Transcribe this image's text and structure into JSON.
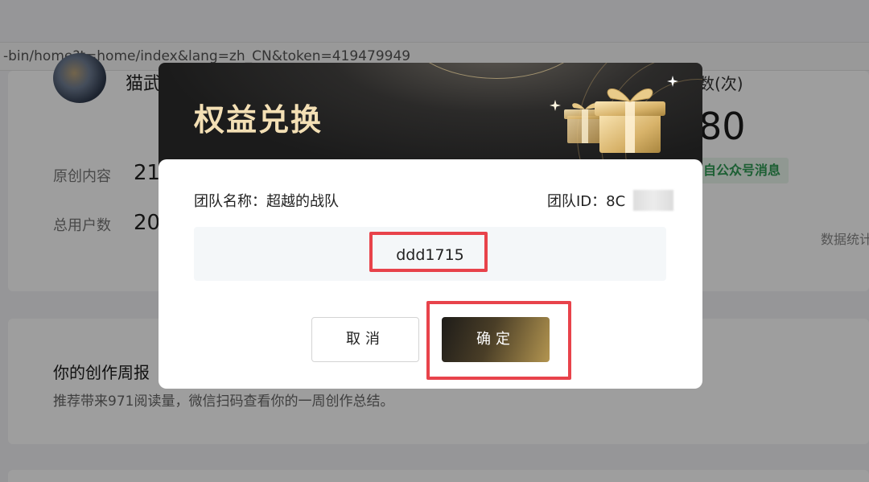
{
  "background": {
    "url_text": "-bin/home?t=home/index&lang=zh_CN&token=419479949",
    "account_name_partial": "猫武",
    "header_right_partial": "数(次)",
    "stats": [
      {
        "label": "原创内容",
        "value": "21"
      },
      {
        "label": "总用户数",
        "value": "20"
      }
    ],
    "big_number_partial": "80",
    "message_tag": "自公众号消息",
    "stats_link_partial": "数据统计",
    "weekly_report": {
      "title": "你的创作周报",
      "description": "推荐带来971阅读量，微信扫码查看你的一周创作总结。"
    }
  },
  "modal": {
    "title": "权益兑换",
    "team_name": "团队名称：超越的战队",
    "team_id_label": "团队ID：",
    "team_id_visible": "8C",
    "code_value": "ddd1715",
    "cancel_label": "取消",
    "confirm_label": "确定",
    "icons": [
      "gift-icon",
      "sparkle-icon"
    ],
    "colors": {
      "accent_gold": "#f3dfb4",
      "highlight_red": "#e8434b",
      "header_dark": "#1b1b1b"
    }
  }
}
